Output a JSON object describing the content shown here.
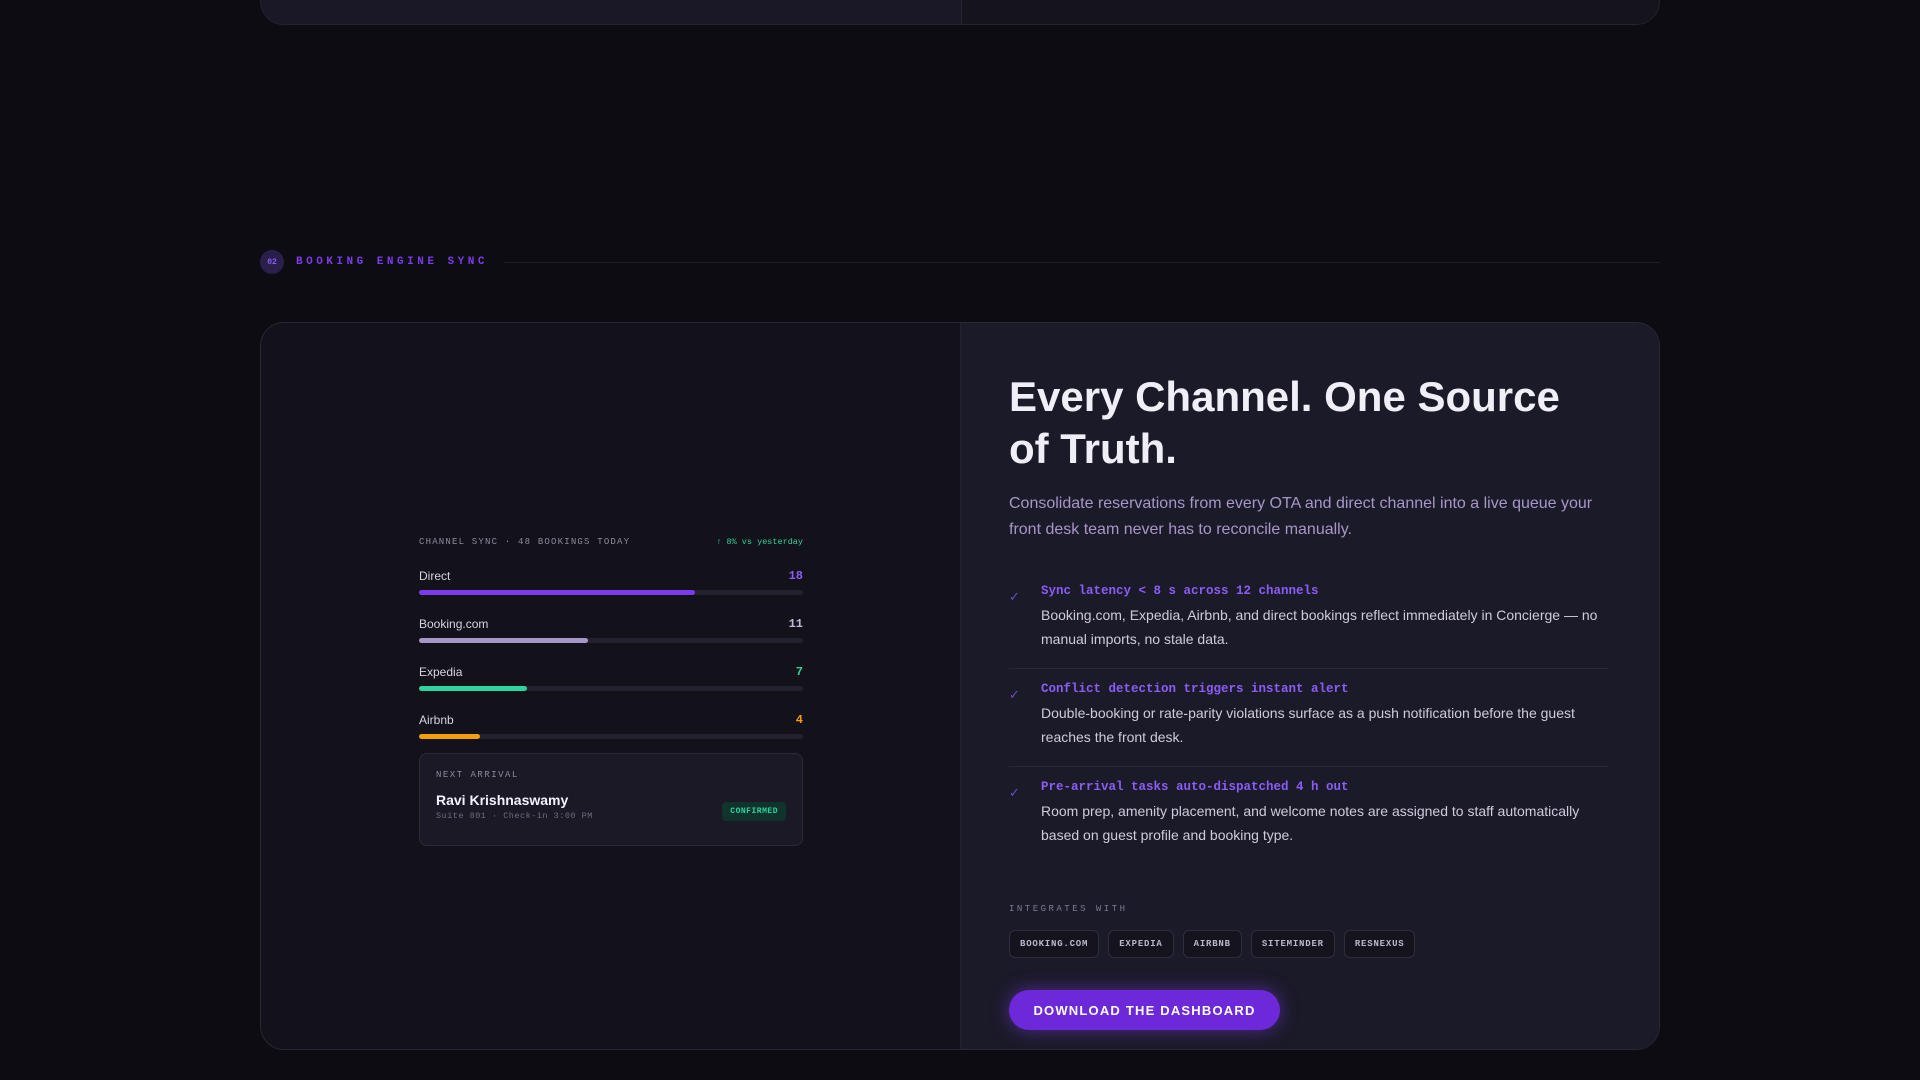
{
  "section": {
    "number": "02",
    "title": "BOOKING ENGINE SYNC"
  },
  "widget": {
    "title": "CHANNEL SYNC · 48 BOOKINGS TODAY",
    "trend": "↑ 8% vs yesterday",
    "max_bookings": 18,
    "channels": [
      {
        "name": "Direct",
        "count": "18",
        "value": 18,
        "color": "#7c3aed",
        "count_color": "#8b5cf6"
      },
      {
        "name": "Booking.com",
        "count": "11",
        "value": 11,
        "color": "#a796c9",
        "count_color": "#c4b8dc"
      },
      {
        "name": "Expedia",
        "count": "7",
        "value": 7,
        "color": "#2bd4a0",
        "count_color": "#2bd4a0"
      },
      {
        "name": "Airbnb",
        "count": "4",
        "value": 4,
        "color": "#f59e0b",
        "count_color": "#f59e0b"
      }
    ],
    "next_arrival": {
      "label": "NEXT ARRIVAL",
      "name": "Ravi Krishnaswamy",
      "details": "Suite 801 · Check-in 3:00 PM",
      "status": "CONFIRMED"
    }
  },
  "content": {
    "headline": "Every Channel. One Source of Truth.",
    "lede": "Consolidate reservations from every OTA and direct channel into a live queue your front desk team never has to reconcile manually.",
    "features": [
      {
        "icon": "check-icon",
        "title": "Sync latency < 8 s across 12 channels",
        "desc": "Booking.com, Expedia, Airbnb, and direct bookings reflect immediately in Concierge — no manual imports, no stale data."
      },
      {
        "icon": "check-icon",
        "title": "Conflict detection triggers instant alert",
        "desc": "Double-booking or rate-parity violations surface as a push notification before the guest reaches the front desk."
      },
      {
        "icon": "check-icon",
        "title": "Pre-arrival tasks auto-dispatched 4 h out",
        "desc": "Room prep, amenity placement, and welcome notes are assigned to staff automatically based on guest profile and booking type."
      }
    ],
    "integrations_label": "INTEGRATES WITH",
    "integrations": [
      "BOOKING.COM",
      "EXPEDIA",
      "AIRBNB",
      "SITEMINDER",
      "RESNEXUS"
    ],
    "cta": "DOWNLOAD THE DASHBOARD"
  },
  "colors": {
    "accent": "#7c3aed",
    "success": "#2bd4a0",
    "warning": "#f59e0b"
  }
}
